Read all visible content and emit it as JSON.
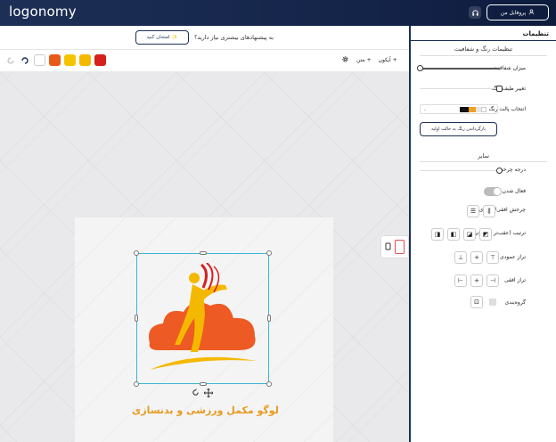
{
  "header": {
    "logo": "logonomy",
    "profile_label": "پروفایل من"
  },
  "canvas": {
    "suggestion_text": "به پیشنهادهای بیشتری نیاز دارید؟",
    "try_button": "امتحان کنید",
    "toolbar": {
      "colors": [
        "#d6201e",
        "#f5b800",
        "#f5c400",
        "#e85a18",
        "#ffffff"
      ],
      "icon_label": "آیکون",
      "text_label": "متن"
    },
    "logo_caption": "لوگو مکمل ورزشی و بدنسازی"
  },
  "panel": {
    "title": "تنظیمات",
    "color_section": "تنظیمات رنگ و شفافیت",
    "opacity_label": "میزان شفافیت",
    "hue_label": "تغییر طیف رنگ",
    "palette_label": "انتخاب پالت رنگ",
    "palette_colors": [
      "#111111",
      "#f0a020",
      "#e8e8e8",
      "#ffffff"
    ],
    "reset_button": "بازگرداندن رنگ به حالت اولیه",
    "other_section": "سایر",
    "rotation_label": "درجه چرخش",
    "shadow_label": "فعال شدن سایه",
    "flip_label": "چرخش افقی/عمودی",
    "order_label": "ترتیب (عقب‌تر یا جلوتر)",
    "valign_label": "تراز عمودی",
    "halign_label": "تراز افقی",
    "group_label": "گروه‌بندی"
  }
}
